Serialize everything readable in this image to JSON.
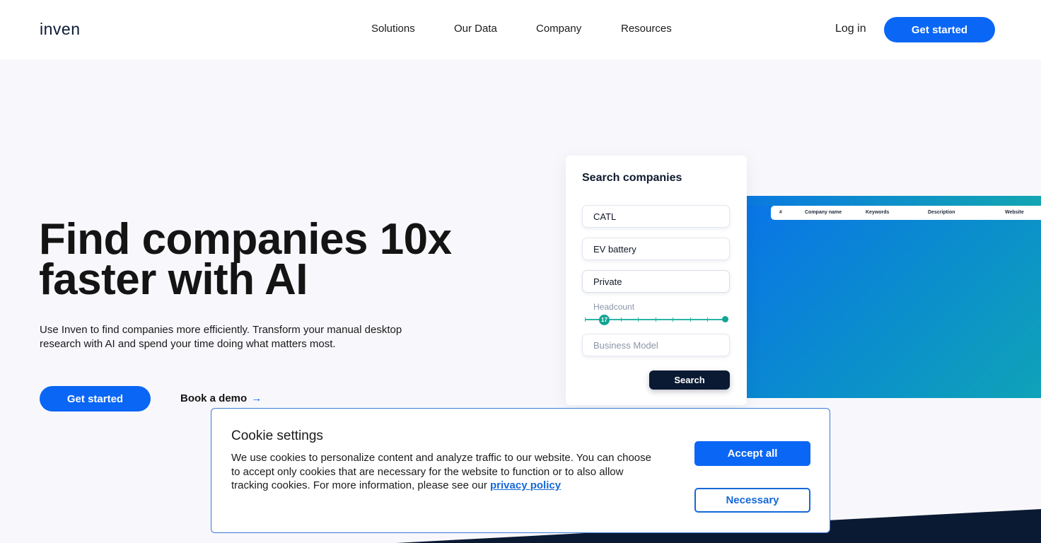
{
  "header": {
    "logo": "inven",
    "nav": [
      "Solutions",
      "Our Data",
      "Company",
      "Resources"
    ],
    "login": "Log in",
    "cta": "Get started"
  },
  "hero": {
    "title_line1": "Find companies 10x",
    "title_line2": "faster with AI",
    "description": "Use Inven to find companies more efficiently. Transform your manual desktop research with AI and spend your time doing what matters most.",
    "cta": "Get started",
    "demo_link": "Book a demo",
    "demo_arrow": "→"
  },
  "search_card": {
    "title": "Search companies",
    "fields": [
      "CATL",
      "EV battery",
      "Private"
    ],
    "headcount_label": "Headcount",
    "headcount_value": "17",
    "business_model_placeholder": "Business Model",
    "search_button": "Search"
  },
  "results_table": {
    "columns": [
      "#",
      "Company name",
      "Keywords",
      "Description",
      "Website"
    ]
  },
  "cookie": {
    "title": "Cookie settings",
    "text": "We use cookies to personalize content and analyze traffic to our website. You can choose to accept only cookies that are necessary for the website to function or to also allow tracking cookies. For more information, please see our",
    "link": "privacy policy",
    "accept": "Accept all",
    "necessary": "Necessary"
  },
  "colors": {
    "accent": "#0a66f4",
    "dark": "#0b1a33",
    "teal": "#14a394",
    "background": "#f8f8fc"
  }
}
